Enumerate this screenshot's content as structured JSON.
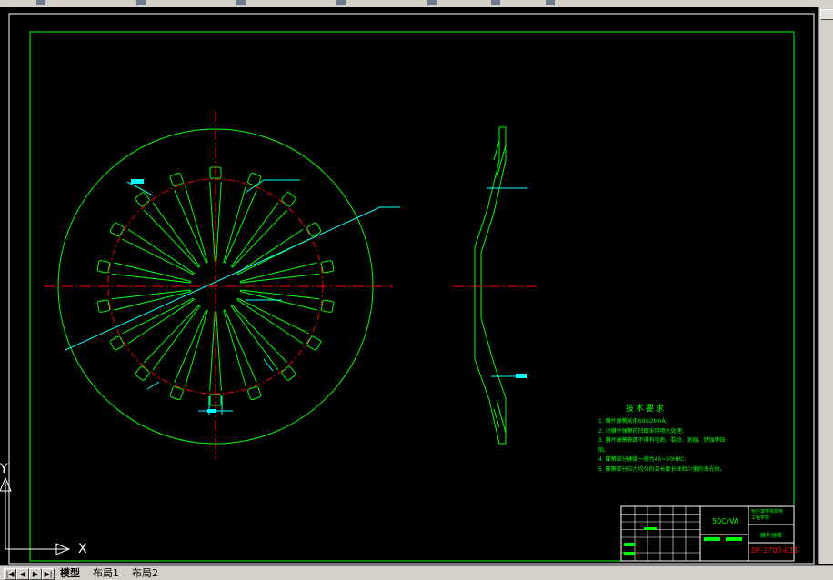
{
  "tabs": [
    {
      "label": "模型",
      "active": true
    },
    {
      "label": "布局1",
      "active": false
    },
    {
      "label": "布局2",
      "active": false
    }
  ],
  "nav_buttons": [
    "|◀",
    "◀",
    "▶",
    "▶|"
  ],
  "ucs": {
    "x_label": "X",
    "y_label": "Y"
  },
  "notes": {
    "title": "技术要求",
    "lines": [
      "1. 膜片弹簧采用60Si2MnA;",
      "2. 对膜片弹簧的凹面采用喷丸处理;",
      "3. 膜片弹簧表面不得有毛刺、裂纹、划痕、锈蚀等缺",
      "陷;",
      "4. 碟簧部分硬度一般为45~50HRC;",
      "5. 碟簧部分应力均匀的且长度长体和少量的发光体。"
    ]
  },
  "title_block": {
    "material": "50CrVA",
    "drawing_number": "DF-1700-011",
    "part_name": "膜片弹簧",
    "school_line1": "哈尔滨学院机电",
    "school_line2": "工程学院"
  },
  "colors": {
    "border": "#00ff00",
    "centerline": "#ff0000",
    "dimension": "#00ffff",
    "title_block_text": "#00ff00",
    "drawing_number": "#ff0000"
  }
}
